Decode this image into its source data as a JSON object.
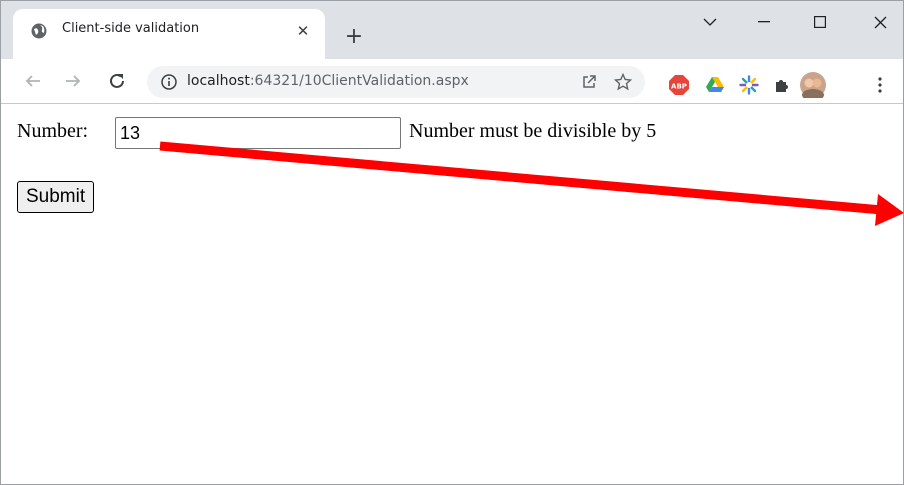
{
  "browser": {
    "tab_title": "Client-side validation",
    "tab_close": "✕",
    "new_tab": "+",
    "url_host": "localhost",
    "url_rest": ":64321/10ClientValidation.aspx"
  },
  "page": {
    "number_label": "Number:",
    "number_value": "13",
    "error_message": "Number must be divisible by 5",
    "submit_label": "Submit"
  },
  "annotation": {
    "arrow_color": "#ff0000"
  },
  "icons": {
    "extensions": [
      "abp-icon",
      "google-drive-icon",
      "colorful-extension-icon",
      "puzzle-icon",
      "profile-avatar"
    ]
  }
}
